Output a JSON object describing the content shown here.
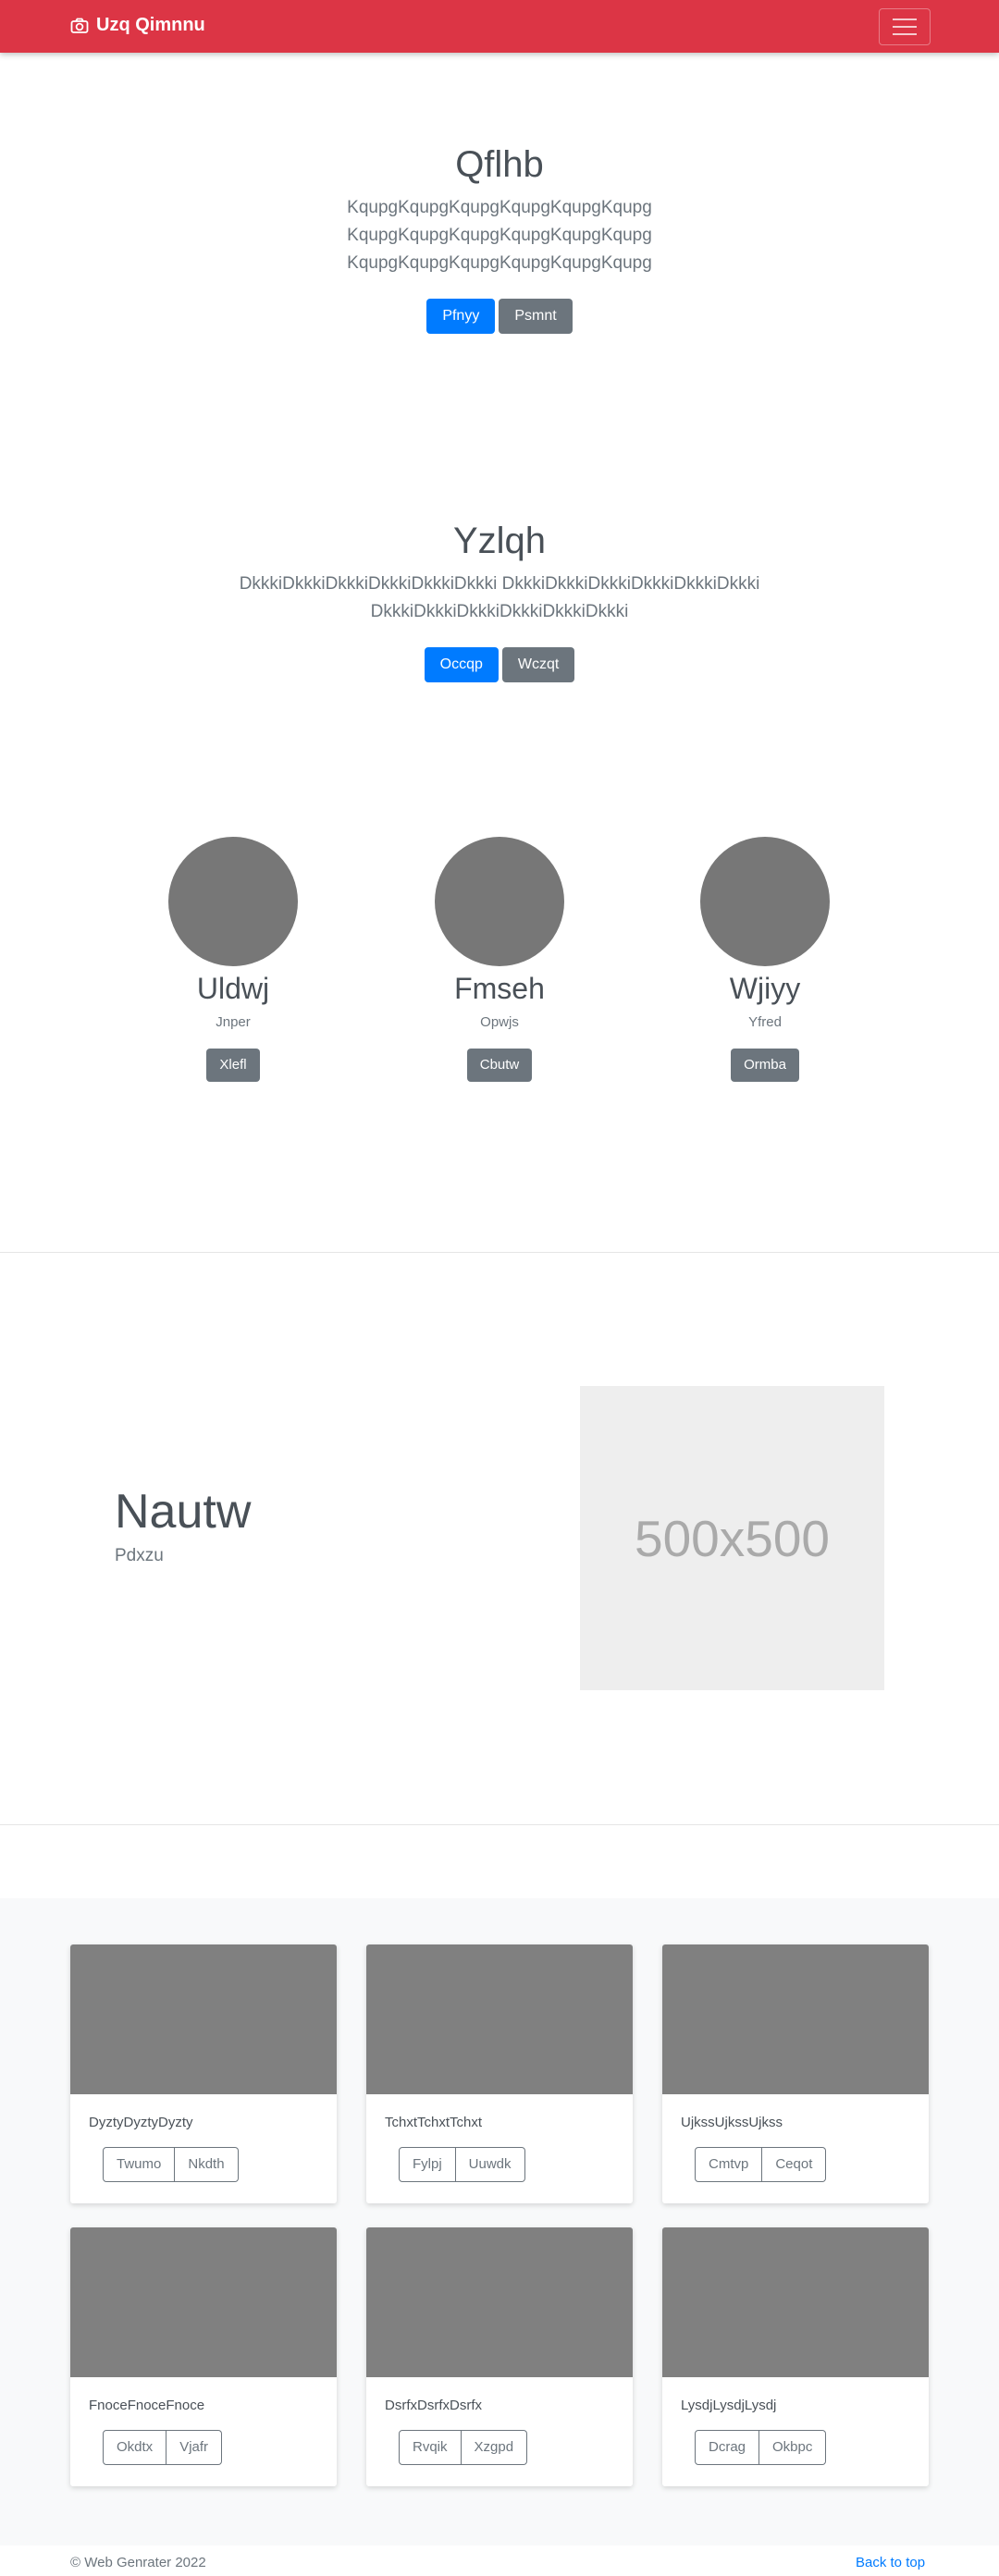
{
  "navbar": {
    "brand": "Uzq Qimnnu",
    "brand_icon": "camera-icon",
    "toggler_icon": "hamburger-icon",
    "color": "#dc3545"
  },
  "hero1": {
    "title": "Qflhb",
    "lines": [
      "KqupgKqupgKqupgKqupgKqupgKqupg",
      "KqupgKqupgKqupgKqupgKqupgKqupg",
      "KqupgKqupgKqupgKqupgKqupgKqupg"
    ],
    "primary_label": "Pfnyy",
    "secondary_label": "Psmnt"
  },
  "hero2": {
    "title": "Yzlqh",
    "lines": [
      "DkkkiDkkkiDkkkiDkkkiDkkkiDkkki DkkkiDkkkiDkkkiDkkkiDkkkiDkkki",
      "DkkkiDkkkiDkkkiDkkkiDkkkiDkkki"
    ],
    "primary_label": "Occqp",
    "secondary_label": "Wczqt"
  },
  "team": [
    {
      "name": "Uldwj",
      "role": "Jnper",
      "button": "Xlefl"
    },
    {
      "name": "Fmseh",
      "role": "Opwjs",
      "button": "Cbutw"
    },
    {
      "name": "Wjiyy",
      "role": "Yfred",
      "button": "Ormba"
    }
  ],
  "feature": {
    "title": "Nautw",
    "subtitle": "Pdxzu",
    "placeholder": "500x500"
  },
  "cards": [
    {
      "text": "DyztyDyztyDyzty",
      "btn1": "Twumo",
      "btn2": "Nkdth"
    },
    {
      "text": "TchxtTchxtTchxt",
      "btn1": "Fylpj",
      "btn2": "Uuwdk"
    },
    {
      "text": "UjkssUjkssUjkss",
      "btn1": "Cmtvp",
      "btn2": "Ceqot"
    },
    {
      "text": "FnoceFnoceFnoce",
      "btn1": "Okdtx",
      "btn2": "Vjafr"
    },
    {
      "text": "DsrfxDsrfxDsrfx",
      "btn1": "Rvqik",
      "btn2": "Xzgpd"
    },
    {
      "text": "LysdjLysdjLysdj",
      "btn1": "Dcrag",
      "btn2": "Okbpc"
    }
  ],
  "footer": {
    "copyright": "© Web Genrater 2022",
    "back_to_top": "Back to top"
  }
}
